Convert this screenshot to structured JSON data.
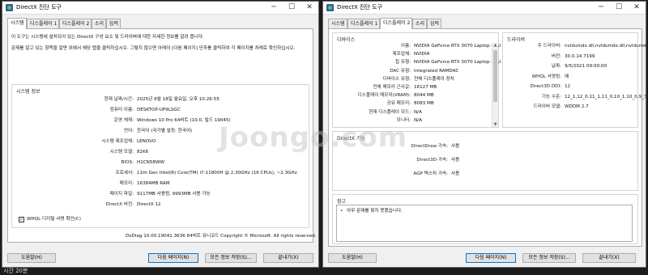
{
  "taskbar_label": "시간 20분",
  "left": {
    "title": "DirectX 진단 도구",
    "tabs": [
      "시스템",
      "디스플레이 1",
      "디스플레이 2",
      "소리",
      "입력"
    ],
    "intro": [
      "이 도구는 시스템에 설치되어 있는 DirectX 구성 요소 및 드라이버에 대한 자세한 정보를 알려 줍니다.",
      "문제를 알고 있는 항목을 알면 위에서 해당 탭을 클릭하십시오. 그렇지 않으면 아래의 [다음 페이지] 단추를 클릭하여 각 페이지를 차례로 확인하십시오."
    ],
    "group_title": "시스템 정보",
    "rows": [
      {
        "label": "현재 날짜/시간:",
        "value": "2025년 8월 18일 월요일, 오후 10:26:55"
      },
      {
        "label": "컴퓨터 이름:",
        "value": "DESKTOP-UP9LSGC"
      },
      {
        "label": "운영 체제:",
        "value": "Windows 10 Pro 64비트 (10.0, 빌드 19045)"
      },
      {
        "label": "언어:",
        "value": "한국어 (국가별 설정: 한국어)"
      },
      {
        "label": "시스템 제조업체:",
        "value": "LENOVO"
      },
      {
        "label": "시스템 모델:",
        "value": "82K6"
      },
      {
        "label": "BIOS:",
        "value": "H1CN58WW"
      },
      {
        "label": "프로세서:",
        "value": "11th Gen Intel(R) Core(TM) i7-11800H @ 2.30GHz (16 CPUs), ~2.3GHz"
      },
      {
        "label": "메모리:",
        "value": "16384MB RAM"
      },
      {
        "label": "페이지 파일:",
        "value": "9117MB 사용됨, 9993MB 사용 가능"
      },
      {
        "label": "DirectX 버전:",
        "value": "DirectX 12"
      }
    ],
    "whql_label": "WHQL 디지털 서명 확인(C)",
    "footer": "DxDiag 10.00.19041.3636 64비트 유니코드  Copyright © Microsoft. All rights reserved.",
    "buttons": {
      "help": "도움말(H)",
      "next": "다음 페이지(N)",
      "save": "모든 정보 저장(S)...",
      "exit": "끝내기(X)"
    }
  },
  "right": {
    "title": "DirectX 진단 도구",
    "tabs": [
      "시스템",
      "디스플레이 1",
      "디스플레이 2",
      "소리",
      "입력"
    ],
    "device_title": "디바이스",
    "device_rows": [
      {
        "label": "이름:",
        "value": "NVIDIA GeForce RTX 3070 Laptop GPU"
      },
      {
        "label": "제조업체:",
        "value": "NVIDIA"
      },
      {
        "label": "칩 유형:",
        "value": "NVIDIA GeForce RTX 3070 Laptop GPU"
      },
      {
        "label": "DAC 유형:",
        "value": "Integrated RAMDAC"
      },
      {
        "label": "디바이스 유형:",
        "value": "전체 디스플레이 장치"
      },
      {
        "label": "전체 메모리 근사값:",
        "value": "16127 MB"
      },
      {
        "label": "디스플레이 메모리(VRAM):",
        "value": "8044 MB"
      },
      {
        "label": "공유 메모리:",
        "value": "8083 MB"
      },
      {
        "label": "현재 디스플레이 모드:",
        "value": "N/A"
      },
      {
        "label": "모니터:",
        "value": "N/A"
      }
    ],
    "driver_title": "드라이버",
    "driver_rows": [
      {
        "label": "주 드라이버:",
        "value": "nvldumdx.dll,nvldumdx.dll,nvldumdx.dl"
      },
      {
        "label": "버전:",
        "value": "30.0.14.7199"
      },
      {
        "label": "날짜:",
        "value": "9/5/2021 09:00:00"
      },
      {
        "label": "WHQL 서명됨:",
        "value": "예"
      },
      {
        "label": "Direct3D DDI:",
        "value": "12"
      },
      {
        "label": "기능 수준:",
        "value": "12_1,12_0,11_1,11_0,10_1,10_0,9_3,9_"
      },
      {
        "label": "드라이버 모델:",
        "value": "WDDM 2.7"
      }
    ],
    "features_title": "DirectX 기능",
    "features": [
      {
        "label": "DirectDraw 가속:",
        "value": "사용"
      },
      {
        "label": "Direct3D 가속:",
        "value": "사용"
      },
      {
        "label": "AGP 텍스처 가속:",
        "value": "사용"
      }
    ],
    "notes_title": "참고",
    "notes": "아무 문제를 찾지 못했습니다.",
    "buttons": {
      "help": "도움말(H)",
      "next": "다음 페이지(N)",
      "save": "모든 정보 저장(S)...",
      "exit": "끝내기(X)"
    }
  },
  "watermark": "Joongo.com"
}
